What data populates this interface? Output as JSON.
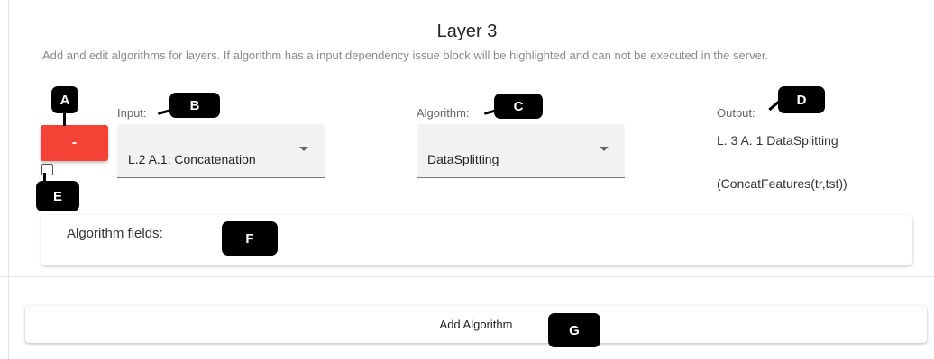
{
  "layer": {
    "title": "Layer 3",
    "description": "Add and edit algorithms for layers. If algorithm has a input dependency issue block will be highlighted and can not be executed in the server."
  },
  "row": {
    "remove_label": "-",
    "input_label": "Input:",
    "input_value": "L.2 A.1: Concatenation",
    "algorithm_label": "Algorithm:",
    "algorithm_value": "DataSplitting",
    "output_label": "Output:",
    "output_line1": "L. 3 A. 1 DataSplitting",
    "output_line2": "(ConcatFeatures(tr,tst))"
  },
  "fields": {
    "label": "Algorithm fields:"
  },
  "add_button": "Add Algorithm",
  "markers": {
    "a": "A",
    "b": "B",
    "c": "C",
    "d": "D",
    "e": "E",
    "f": "F",
    "g": "G"
  },
  "colors": {
    "remove_button": "#f44336",
    "marker": "#000000"
  }
}
